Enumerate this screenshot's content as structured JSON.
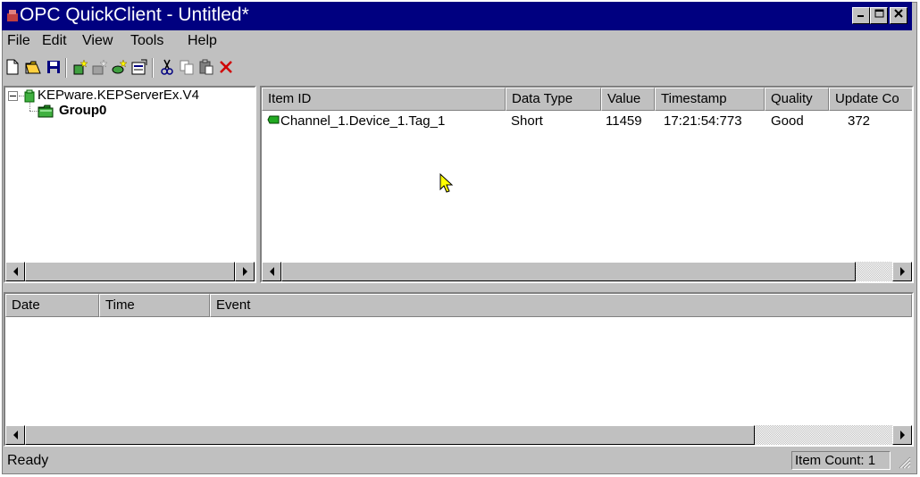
{
  "window": {
    "title": "OPC QuickClient - Untitled*"
  },
  "menu": {
    "items": [
      {
        "label": "File"
      },
      {
        "label": "Edit"
      },
      {
        "label": "View"
      },
      {
        "label": "Tools"
      },
      {
        "label": "Help"
      }
    ]
  },
  "tree": {
    "server": "KEPware.KEPServerEx.V4",
    "group": "Group0"
  },
  "items_table": {
    "columns": [
      "Item ID",
      "Data Type",
      "Value",
      "Timestamp",
      "Quality",
      "Update Co"
    ],
    "rows": [
      {
        "item_id": "Channel_1.Device_1.Tag_1",
        "data_type": "Short",
        "value": "11459",
        "timestamp": "17:21:54:773",
        "quality": "Good",
        "update_count": "372"
      }
    ]
  },
  "event_log": {
    "columns": [
      "Date",
      "Time",
      "Event"
    ]
  },
  "status": {
    "ready": "Ready",
    "item_count": "Item Count: 1"
  },
  "colors": {
    "titlebar": "#000080",
    "face": "#c0c0c0",
    "tag_icon": "#22aa22"
  }
}
